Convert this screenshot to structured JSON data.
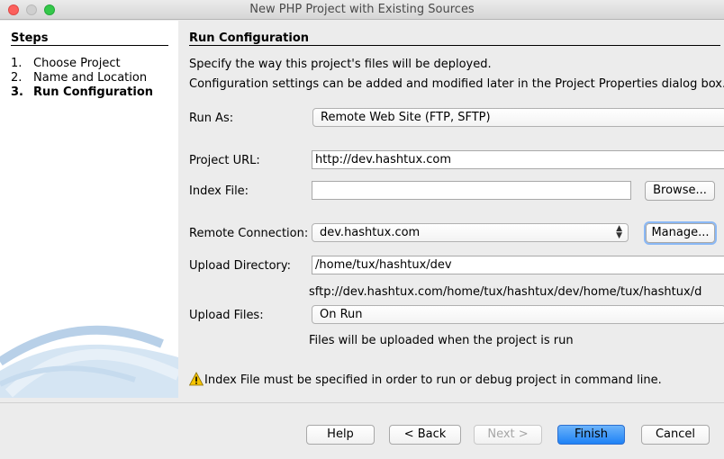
{
  "window": {
    "title": "New PHP Project with Existing Sources"
  },
  "steps": {
    "heading": "Steps",
    "items": [
      {
        "num": "1.",
        "label": "Choose Project"
      },
      {
        "num": "2.",
        "label": "Name and Location"
      },
      {
        "num": "3.",
        "label": "Run Configuration"
      }
    ]
  },
  "run_config": {
    "heading": "Run Configuration",
    "desc1": "Specify the way this project's files will be deployed.",
    "desc2": "Configuration settings can be added and modified later in the Project Properties dialog box.",
    "run_as_label": "Run As:",
    "run_as_value": "Remote Web Site (FTP, SFTP)",
    "project_url_label": "Project URL:",
    "project_url_value": "http://dev.hashtux.com",
    "index_file_label": "Index File:",
    "index_file_value": "",
    "browse_label": "Browse...",
    "remote_conn_label": "Remote Connection:",
    "remote_conn_value": "dev.hashtux.com",
    "manage_label": "Manage...",
    "upload_dir_label": "Upload Directory:",
    "upload_dir_value": "/home/tux/hashtux/dev",
    "upload_path_preview": "sftp://dev.hashtux.com/home/tux/hashtux/dev/home/tux/hashtux/d",
    "upload_files_label": "Upload Files:",
    "upload_files_value": "On Run",
    "upload_files_hint": "Files will be uploaded when the project is run",
    "warning": "Index File must be specified in order to run or debug project in command line."
  },
  "buttons": {
    "help": "Help",
    "back": "< Back",
    "next": "Next >",
    "finish": "Finish",
    "cancel": "Cancel"
  }
}
